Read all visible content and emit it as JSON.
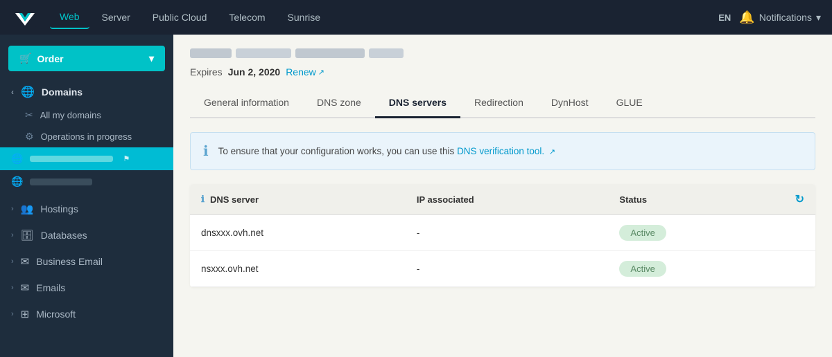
{
  "topnav": {
    "logo_alt": "OVH Logo",
    "items": [
      {
        "label": "Web",
        "active": true
      },
      {
        "label": "Server",
        "active": false
      },
      {
        "label": "Public Cloud",
        "active": false
      },
      {
        "label": "Telecom",
        "active": false
      },
      {
        "label": "Sunrise",
        "active": false
      }
    ],
    "lang": "EN",
    "notifications": "Notifications"
  },
  "sidebar": {
    "order_label": "Order",
    "sections": [
      {
        "label": "Domains",
        "icon": "globe",
        "chevron": "›",
        "sub_items": [
          {
            "label": "All my domains",
            "icon": "⚙"
          },
          {
            "label": "Operations in progress",
            "icon": "⚙"
          }
        ],
        "domain_items": [
          {
            "placeholder": true,
            "active": true
          },
          {
            "placeholder": true,
            "active": false
          }
        ]
      }
    ],
    "nav_items": [
      {
        "label": "Hostings",
        "icon": "👥"
      },
      {
        "label": "Databases",
        "icon": "🗄"
      },
      {
        "label": "Business Email",
        "icon": "✉"
      },
      {
        "label": "Emails",
        "icon": "✉"
      },
      {
        "label": "Microsoft",
        "icon": "⊞"
      }
    ]
  },
  "content": {
    "expires_label": "Expires",
    "expires_date": "Jun 2, 2020",
    "renew_label": "Renew",
    "tabs": [
      {
        "label": "General information",
        "active": false
      },
      {
        "label": "DNS zone",
        "active": false
      },
      {
        "label": "DNS servers",
        "active": true
      },
      {
        "label": "Redirection",
        "active": false
      },
      {
        "label": "DynHost",
        "active": false
      },
      {
        "label": "GLUE",
        "active": false
      }
    ],
    "info_box": {
      "text": "To ensure that your configuration works, you can use this",
      "link_text": "DNS verification tool.",
      "external": true
    },
    "table": {
      "columns": [
        {
          "label": "DNS server",
          "has_info": true
        },
        {
          "label": "IP associated"
        },
        {
          "label": "Status"
        },
        {
          "label": "refresh",
          "is_icon": true
        }
      ],
      "rows": [
        {
          "dns": "dnsxxx.ovh.net",
          "ip": "-",
          "status": "Active"
        },
        {
          "dns": "nsxxx.ovh.net",
          "ip": "-",
          "status": "Active"
        }
      ]
    }
  }
}
